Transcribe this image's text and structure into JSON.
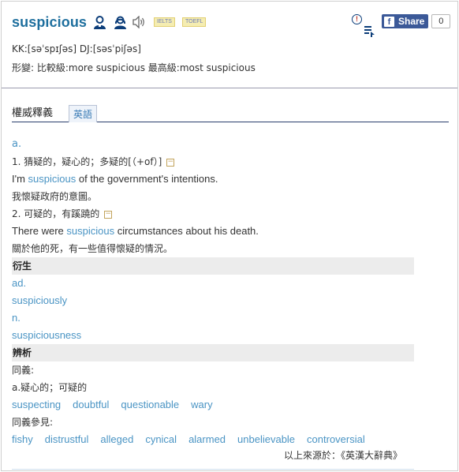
{
  "headword": "suspicious",
  "badges": [
    "IELTS",
    "TOEFL"
  ],
  "share": {
    "label": "Share",
    "count": "0"
  },
  "phonetics": "KK:[səˈspɪʃəs] DJ:[səsˈpiʃəs]",
  "forms": "形變: 比較級:more suspicious  最高級:most suspicious",
  "tabs": [
    "權威釋義",
    "英語"
  ],
  "pos": "a.",
  "senses": [
    {
      "def": "1. 猜疑的，疑心的；多疑的[（+of）]",
      "ex_before": "I'm ",
      "ex_word": "suspicious",
      "ex_after": " of the government's intentions.",
      "ex_zh": "我懷疑政府的意圖。"
    },
    {
      "def": "2. 可疑的，有蹊蹺的",
      "ex_before": "There were ",
      "ex_word": "suspicious",
      "ex_after": " circumstances about his death.",
      "ex_zh": "關於他的死，有一些值得懷疑的情況。"
    }
  ],
  "derived": {
    "title": "衍生",
    "items": [
      {
        "pos": "ad.",
        "word": "suspiciously"
      },
      {
        "pos": "n.",
        "word": "suspiciousness"
      }
    ]
  },
  "analysis": {
    "title": "辨析",
    "synonyms_label": "同義:",
    "synonyms_sense": "a.疑心的；可疑的",
    "synonyms": [
      "suspecting",
      "doubtful",
      "questionable",
      "wary"
    ],
    "see_also_label": "同義參見:",
    "see_also": [
      "fishy",
      "distrustful",
      "alleged",
      "cynical",
      "alarmed",
      "unbelievable",
      "controversial"
    ]
  },
  "source": "以上來源於：《英漢大辭典》",
  "colors": {
    "link": "#4a94c4",
    "headword": "#1e6f9e",
    "facebook": "#3b5998"
  }
}
